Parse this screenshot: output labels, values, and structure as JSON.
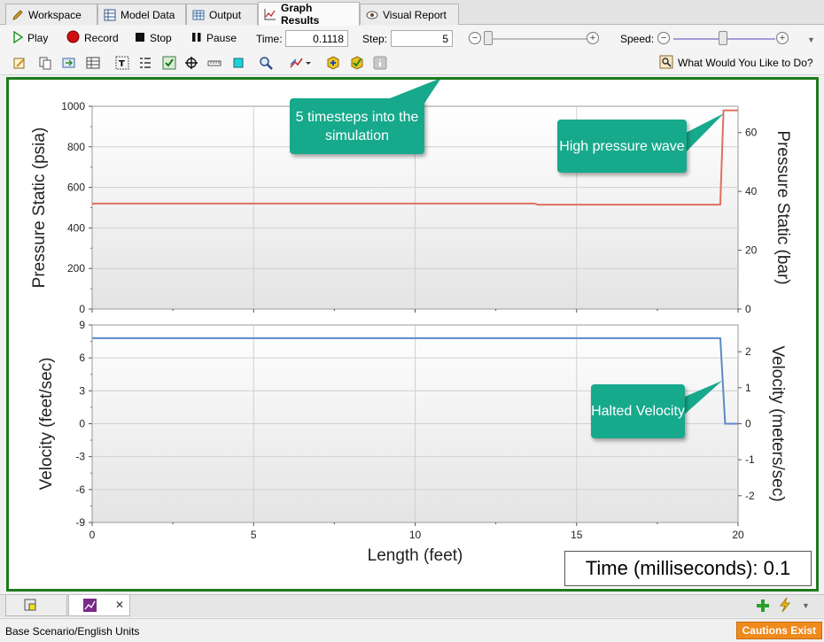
{
  "tabs": [
    {
      "label": "Workspace",
      "icon": "pencil-icon",
      "active": false
    },
    {
      "label": "Model Data",
      "icon": "table-icon",
      "active": false
    },
    {
      "label": "Output",
      "icon": "grid-icon",
      "active": false
    },
    {
      "label": "Graph Results",
      "icon": "chart-icon",
      "active": true
    },
    {
      "label": "Visual Report",
      "icon": "eye-icon",
      "active": false
    }
  ],
  "playback": {
    "play_label": "Play",
    "record_label": "Record",
    "stop_label": "Stop",
    "pause_label": "Pause",
    "time_label": "Time:",
    "time_value": "0.1118",
    "step_label": "Step:",
    "step_value": "5",
    "speed_label": "Speed:"
  },
  "toolbar2": {
    "help_label": "What Would You Like to Do?"
  },
  "callouts": {
    "timesteps": "5 timesteps into the simulation",
    "high_pressure": "High pressure wave",
    "halted_velocity": "Halted Velocity"
  },
  "time_display": "Time (milliseconds): 0.1",
  "colors": {
    "frame": "#1e7a1e",
    "pressure_line": "#e07060",
    "velocity_line": "#5b8ac8",
    "callout": "#17a98c",
    "caution": "#f08a1c"
  },
  "chart_data": [
    {
      "type": "line",
      "title": "",
      "xlabel": "",
      "ylabel": "Pressure Static (psia)",
      "ylabel_right": "Pressure Static (bar)",
      "xlim": [
        0,
        20
      ],
      "ylim": [
        0,
        1000
      ],
      "ylim_right": [
        0,
        68.95
      ],
      "yticks": [
        0,
        200,
        400,
        600,
        800,
        1000
      ],
      "yticks_right": [
        0,
        20,
        40,
        60
      ],
      "grid": true,
      "series": [
        {
          "x": [
            0,
            13.7,
            13.8,
            19.45,
            19.55,
            20
          ],
          "y": [
            520,
            520,
            515,
            515,
            980,
            980
          ]
        }
      ]
    },
    {
      "type": "line",
      "title": "",
      "xlabel": "Length (feet)",
      "ylabel": "Velocity (feet/sec)",
      "ylabel_right": "Velocity (meters/sec)",
      "xlim": [
        0,
        20
      ],
      "ylim": [
        -9,
        9
      ],
      "ylim_right": [
        -2.743,
        2.743
      ],
      "xticks": [
        0,
        5,
        10,
        15,
        20
      ],
      "yticks": [
        -9,
        -6,
        -3,
        0,
        3,
        6,
        9
      ],
      "yticks_right": [
        -2,
        -1,
        0,
        1,
        2
      ],
      "grid": true,
      "series": [
        {
          "x": [
            0,
            19.45,
            19.6,
            20
          ],
          "y": [
            7.8,
            7.8,
            0,
            0
          ]
        }
      ]
    }
  ],
  "bottom": {
    "status_text": "Base Scenario/English Units",
    "caution_label": "Cautions Exist",
    "close_glyph": "✕"
  }
}
